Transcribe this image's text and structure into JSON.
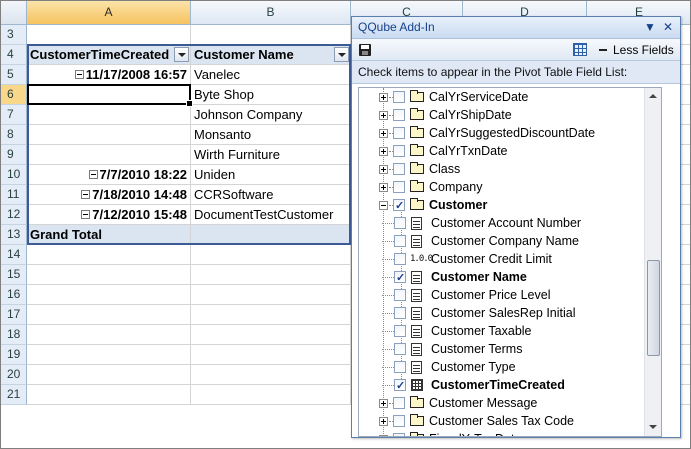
{
  "sheet": {
    "columns": [
      {
        "label": "",
        "sel": false
      },
      {
        "label": "A",
        "sel": true
      },
      {
        "label": "B",
        "sel": false
      },
      {
        "label": "C",
        "sel": false
      },
      {
        "label": "D",
        "sel": false
      },
      {
        "label": "E",
        "sel": false
      }
    ],
    "rows": [
      {
        "num": "3",
        "sel": false
      },
      {
        "num": "4",
        "sel": false
      },
      {
        "num": "5",
        "sel": false
      },
      {
        "num": "6",
        "sel": true
      },
      {
        "num": "7",
        "sel": false
      },
      {
        "num": "8",
        "sel": false
      },
      {
        "num": "9",
        "sel": false
      },
      {
        "num": "10",
        "sel": false
      },
      {
        "num": "11",
        "sel": false
      },
      {
        "num": "12",
        "sel": false
      },
      {
        "num": "13",
        "sel": false
      },
      {
        "num": "14",
        "sel": false
      },
      {
        "num": "15",
        "sel": false
      },
      {
        "num": "16",
        "sel": false
      },
      {
        "num": "17",
        "sel": false
      },
      {
        "num": "18",
        "sel": false
      },
      {
        "num": "19",
        "sel": false
      },
      {
        "num": "20",
        "sel": false
      },
      {
        "num": "21",
        "sel": false
      }
    ],
    "pivot": {
      "header_a": "CustomerTimeCreated",
      "header_b": "Customer Name",
      "records": [
        {
          "a": "11/17/2008 16:57",
          "b": "Vanelec",
          "group": true
        },
        {
          "a": "",
          "b": "Byte Shop",
          "group": false
        },
        {
          "a": "",
          "b": "Johnson Company",
          "group": false
        },
        {
          "a": "",
          "b": "Monsanto",
          "group": false
        },
        {
          "a": "",
          "b": "Wirth Furniture",
          "group": false
        },
        {
          "a": "7/7/2010 18:22",
          "b": "Uniden",
          "group": true
        },
        {
          "a": "7/18/2010 14:48",
          "b": "CCRSoftware",
          "group": true
        },
        {
          "a": "7/12/2010 15:48",
          "b": "DocumentTestCustomer",
          "group": true
        }
      ],
      "grand_total": "Grand Total"
    }
  },
  "pane": {
    "title": "QQube Add-In",
    "dropdown_glyph": "▼",
    "close_glyph": "✕",
    "less_fields": "Less Fields",
    "instruction": "Check items to appear in the Pivot Table Field List:",
    "items": [
      {
        "label": "CalYrServiceDate",
        "level": 0,
        "type": "folder",
        "checked": false,
        "expand": "plus",
        "bold": false
      },
      {
        "label": "CalYrShipDate",
        "level": 0,
        "type": "folder",
        "checked": false,
        "expand": "plus",
        "bold": false
      },
      {
        "label": "CalYrSuggestedDiscountDate",
        "level": 0,
        "type": "folder",
        "checked": false,
        "expand": "plus",
        "bold": false
      },
      {
        "label": "CalYrTxnDate",
        "level": 0,
        "type": "folder",
        "checked": false,
        "expand": "plus",
        "bold": false
      },
      {
        "label": "Class",
        "level": 0,
        "type": "folder",
        "checked": false,
        "expand": "plus",
        "bold": false
      },
      {
        "label": "Company",
        "level": 0,
        "type": "folder",
        "checked": false,
        "expand": "plus",
        "bold": false
      },
      {
        "label": "Customer",
        "level": 0,
        "type": "folder",
        "checked": true,
        "expand": "minus",
        "bold": true
      },
      {
        "label": "Customer Account Number",
        "level": 1,
        "type": "doc",
        "checked": false,
        "bold": false
      },
      {
        "label": "Customer Company Name",
        "level": 1,
        "type": "doc",
        "checked": false,
        "bold": false
      },
      {
        "label": "Customer Credit Limit",
        "level": 1,
        "type": "num",
        "checked": false,
        "bold": false
      },
      {
        "label": "Customer Name",
        "level": 1,
        "type": "doc",
        "checked": true,
        "bold": true
      },
      {
        "label": "Customer Price Level",
        "level": 1,
        "type": "doc",
        "checked": false,
        "bold": false
      },
      {
        "label": "Customer SalesRep Initial",
        "level": 1,
        "type": "doc",
        "checked": false,
        "bold": false
      },
      {
        "label": "Customer Taxable",
        "level": 1,
        "type": "doc",
        "checked": false,
        "bold": false
      },
      {
        "label": "Customer Terms",
        "level": 1,
        "type": "doc",
        "checked": false,
        "bold": false
      },
      {
        "label": "Customer Type",
        "level": 1,
        "type": "doc",
        "checked": false,
        "bold": false
      },
      {
        "label": "CustomerTimeCreated",
        "level": 1,
        "type": "cal",
        "checked": true,
        "bold": true
      },
      {
        "label": "Customer Message",
        "level": 0,
        "type": "folder",
        "checked": false,
        "expand": "plus",
        "bold": false
      },
      {
        "label": "Customer Sales Tax Code",
        "level": 0,
        "type": "folder",
        "checked": false,
        "expand": "plus",
        "bold": false
      },
      {
        "label": "FiscalYrTxnDate",
        "level": 0,
        "type": "folder",
        "checked": false,
        "expand": "plus",
        "bold": false
      }
    ],
    "num_icon_text": "1.0.0"
  }
}
